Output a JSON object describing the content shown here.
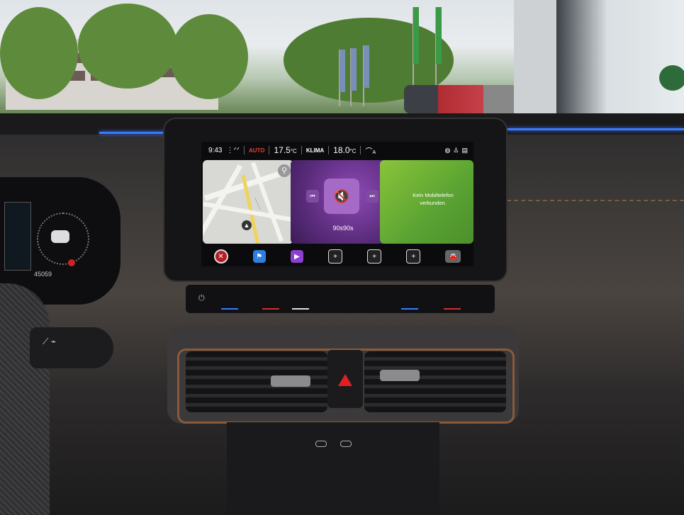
{
  "status_bar": {
    "time": "9:43",
    "seat_heat_mode": "AUTO",
    "left_temp": "17.5",
    "left_temp_unit": "°C",
    "climate_label": "KLIMA",
    "right_temp": "18.0",
    "right_temp_unit": "°C",
    "drive_mode": "A"
  },
  "tiles": {
    "map_search_icon": "search-icon",
    "media_title": "90s90s",
    "phone_message": "Kein Mobiltelefon verbunden."
  },
  "cluster": {
    "odometer": "45059"
  },
  "colors": {
    "auto_red": "#e0463a",
    "media_purple": "#8d49b5",
    "phone_green": "#6cb832",
    "ambient_blue": "#3b7bff",
    "hazard_red": "#e02020"
  }
}
